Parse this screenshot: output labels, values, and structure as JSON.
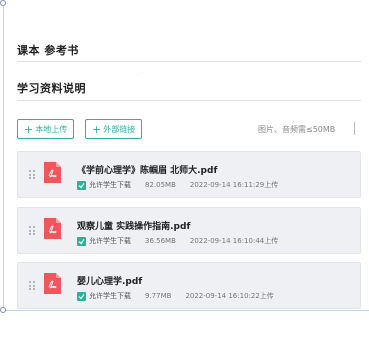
{
  "sections": {
    "textbook_title": "课本 参考书",
    "materials_title": "学习资料说明"
  },
  "toolbar": {
    "local_upload_label": "本地上传",
    "external_link_label": "外部链接",
    "hint": "图片、音频需≤50MB"
  },
  "files": [
    {
      "name": "《学前心理学》陈帼眉 北师大.pdf",
      "allow_label": "允许学生下载",
      "size": "82.05MB",
      "time": "2022-09-14 16:11:29上传"
    },
    {
      "name": "观察儿童 实践操作指南.pdf",
      "allow_label": "允许学生下载",
      "size": "36.56MB",
      "time": "2022-09-14 16:10:44上传"
    },
    {
      "name": "婴儿心理学.pdf",
      "allow_label": "允许学生下载",
      "size": "9.77MB",
      "time": "2022-09-14 16:10:22上传"
    }
  ],
  "colors": {
    "accent": "#2bb39a",
    "pdf_red": "#f0565b"
  }
}
